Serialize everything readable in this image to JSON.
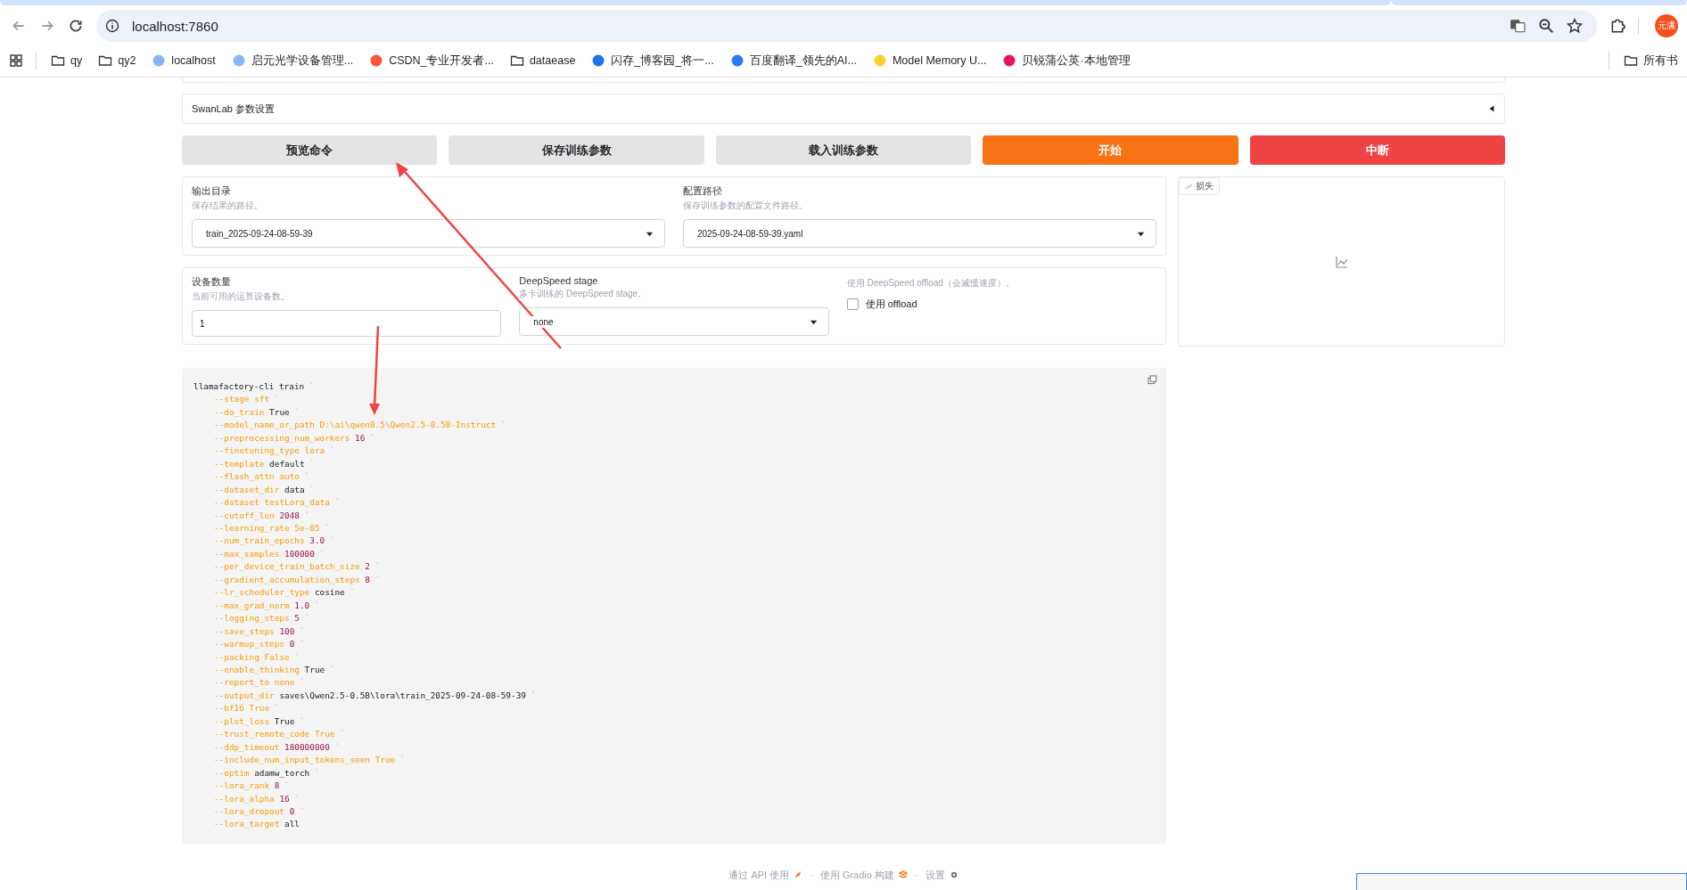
{
  "browser": {
    "url": "localhost:7860",
    "profile": "元满",
    "bookmarks": [
      {
        "label": "qy",
        "kind": "folder"
      },
      {
        "label": "qy2",
        "kind": "folder"
      },
      {
        "label": "localhost",
        "kind": "site",
        "color": "#8ab4f8"
      },
      {
        "label": "启元光学设备管理...",
        "kind": "site",
        "color": "#8ab4f8"
      },
      {
        "label": "CSDN_专业开发者...",
        "kind": "site",
        "color": "#fc5531"
      },
      {
        "label": "dataease",
        "kind": "folder"
      },
      {
        "label": "闪存_博客园_将一...",
        "kind": "site",
        "color": "#1a73e8"
      },
      {
        "label": "百度翻译_领先的AI...",
        "kind": "site",
        "color": "#2b7bf5"
      },
      {
        "label": "Model Memory U...",
        "kind": "site",
        "color": "#ffcc33"
      },
      {
        "label": "贝锐蒲公英·本地管理",
        "kind": "site",
        "color": "#e8175d"
      }
    ],
    "other_bookmarks": "所有书"
  },
  "accordion": {
    "title": "SwanLab 参数设置",
    "expanded": false
  },
  "buttons": [
    {
      "label": "预览命令",
      "kind": "secondary"
    },
    {
      "label": "保存训练参数",
      "kind": "secondary"
    },
    {
      "label": "载入训练参数",
      "kind": "secondary"
    },
    {
      "label": "开始",
      "kind": "primary"
    },
    {
      "label": "中断",
      "kind": "stop"
    }
  ],
  "paths": [
    {
      "label": "输出目录",
      "info": "保存结果的路径。",
      "value": "train_2025-09-24-08-59-39"
    },
    {
      "label": "配置路径",
      "info": "保存训练参数的配置文件路径。",
      "value": "2025-09-24-08-59-39.yaml"
    }
  ],
  "device": {
    "label": "设备数量",
    "info": "当前可用的运算设备数。",
    "value": "1"
  },
  "ds_stage": {
    "label": "DeepSpeed stage",
    "info": "多卡训练的 DeepSpeed stage。",
    "value": "none"
  },
  "offload": {
    "info": "使用 DeepSpeed offload（会减慢速度）。",
    "label": "使用 offload",
    "checked": false
  },
  "plot": {
    "label": "损失"
  },
  "command": [
    {
      "kind": "command",
      "flag": "llamafactory-cli train",
      "end": "`"
    },
    {
      "kind": "keyword",
      "flag": "--stage",
      "value": "sft",
      "end": "`"
    },
    {
      "kind": "plain",
      "flag": "--do_train",
      "value": "True",
      "end": "`"
    },
    {
      "kind": "keyword",
      "flag": "--model_name_or_path",
      "value": "D:\\ai\\qwen0.5\\Qwen2.5-0.5B-Instruct",
      "end": "`"
    },
    {
      "kind": "number",
      "flag": "--preprocessing_num_workers",
      "value": "16",
      "end": "`"
    },
    {
      "kind": "keyword",
      "flag": "--finetuning_type",
      "value": "lora",
      "end": "`"
    },
    {
      "kind": "plain",
      "flag": "--template",
      "value": "default",
      "end": "`"
    },
    {
      "kind": "keyword",
      "flag": "--flash_attn",
      "value": "auto",
      "end": "`"
    },
    {
      "kind": "plain",
      "flag": "--dataset_dir",
      "value": "data",
      "end": "`"
    },
    {
      "kind": "keyword",
      "flag": "--dataset",
      "value": "testLora_data",
      "end": "`"
    },
    {
      "kind": "number",
      "flag": "--cutoff_len",
      "value": "2048",
      "end": "`"
    },
    {
      "kind": "keyword",
      "flag": "--learning_rate",
      "value": "5e-05",
      "end": "`"
    },
    {
      "kind": "number",
      "flag": "--num_train_epochs",
      "value": "3.0",
      "end": "`"
    },
    {
      "kind": "number",
      "flag": "--max_samples",
      "value": "100000",
      "end": "`"
    },
    {
      "kind": "number",
      "flag": "--per_device_train_batch_size",
      "value": "2",
      "end": "`"
    },
    {
      "kind": "number",
      "flag": "--gradient_accumulation_steps",
      "value": "8",
      "end": "`"
    },
    {
      "kind": "plain",
      "flag": "--lr_scheduler_type",
      "value": "cosine",
      "end": "`"
    },
    {
      "kind": "number",
      "flag": "--max_grad_norm",
      "value": "1.0",
      "end": "`"
    },
    {
      "kind": "number",
      "flag": "--logging_steps",
      "value": "5",
      "end": "`"
    },
    {
      "kind": "number",
      "flag": "--save_steps",
      "value": "100",
      "end": "`"
    },
    {
      "kind": "number",
      "flag": "--warmup_steps",
      "value": "0",
      "end": "`"
    },
    {
      "kind": "keyword",
      "flag": "--packing",
      "value": "False",
      "end": "`"
    },
    {
      "kind": "plain",
      "flag": "--enable_thinking",
      "value": "True",
      "end": "`"
    },
    {
      "kind": "keyword",
      "flag": "--report_to",
      "value": "none",
      "end": "`"
    },
    {
      "kind": "plain",
      "flag": "--output_dir",
      "value": "saves\\Qwen2.5-0.5B\\lora\\train_2025-09-24-08-59-39",
      "end": "`"
    },
    {
      "kind": "keyword",
      "flag": "--bf16",
      "value": "True",
      "end": "`"
    },
    {
      "kind": "plain",
      "flag": "--plot_loss",
      "value": "True",
      "end": "`"
    },
    {
      "kind": "keyword",
      "flag": "--trust_remote_code",
      "value": "True",
      "end": "`"
    },
    {
      "kind": "number",
      "flag": "--ddp_timeout",
      "value": "180000000",
      "end": "`"
    },
    {
      "kind": "keyword",
      "flag": "--include_num_input_tokens_seen",
      "value": "True",
      "end": "`"
    },
    {
      "kind": "plain",
      "flag": "--optim",
      "value": "adamw_torch",
      "end": "`"
    },
    {
      "kind": "number",
      "flag": "--lora_rank",
      "value": "8",
      "end": "`"
    },
    {
      "kind": "number",
      "flag": "--lora_alpha",
      "value": "16",
      "end": "`"
    },
    {
      "kind": "number",
      "flag": "--lora_dropout",
      "value": "0",
      "end": "`"
    },
    {
      "kind": "plain",
      "flag": "--lora_target",
      "value": "all"
    }
  ],
  "footer": [
    {
      "kind": "api",
      "label": "通过 API 使用"
    },
    {
      "kind": "sep",
      "label": "·"
    },
    {
      "kind": "gradio",
      "label": "使用 Gradio 构建"
    },
    {
      "kind": "sep",
      "label": "·"
    },
    {
      "kind": "settings",
      "label": "设置"
    }
  ]
}
